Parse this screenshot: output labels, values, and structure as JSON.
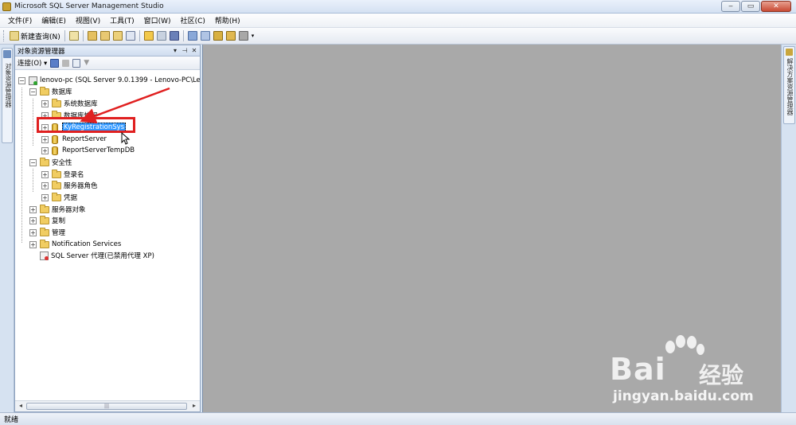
{
  "window": {
    "title": "Microsoft SQL Server Management Studio"
  },
  "menu": [
    {
      "label": "文件(F)"
    },
    {
      "label": "编辑(E)"
    },
    {
      "label": "视图(V)"
    },
    {
      "label": "工具(T)"
    },
    {
      "label": "窗口(W)"
    },
    {
      "label": "社区(C)"
    },
    {
      "label": "帮助(H)"
    }
  ],
  "toolbar": {
    "new_query_label": "新建查询(N)"
  },
  "left_tab": {
    "label": "对象资源管理器"
  },
  "right_tab": {
    "label": "解决方案资源管理器"
  },
  "object_explorer": {
    "title": "对象资源管理器",
    "connect_label": "连接(O)",
    "tree": {
      "server": "lenovo-pc (SQL Server 9.0.1399 - Lenovo-PC\\Le",
      "databases": "数据库",
      "system_databases": "系统数据库",
      "db_snapshots": "数据库快照",
      "selected_db": "KyRegistrationSys",
      "report_server": "ReportServer",
      "report_server_temp": "ReportServerTempDB",
      "security": "安全性",
      "logins": "登录名",
      "server_roles": "服务器角色",
      "credentials": "凭据",
      "server_objects": "服务器对象",
      "replication": "复制",
      "management": "管理",
      "notification_services": "Notification Services",
      "sql_agent": "SQL Server 代理(已禁用代理 XP)"
    }
  },
  "status": {
    "text": "就绪"
  },
  "watermark": {
    "brand": "Bai",
    "sub": "经验",
    "url": "jingyan.baidu.com"
  },
  "colors": {
    "highlight_box": "#e02020",
    "selection": "#3399ff",
    "main_area": "#a9a9a9"
  }
}
